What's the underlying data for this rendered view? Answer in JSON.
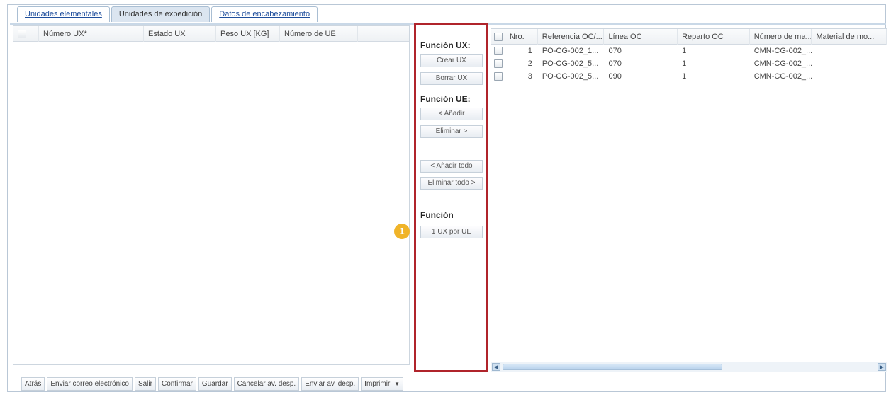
{
  "tabs": [
    {
      "label": "Unidades elementales",
      "active": false
    },
    {
      "label": "Unidades de expedición",
      "active": true
    },
    {
      "label": "Datos de encabezamiento",
      "active": false
    }
  ],
  "left_grid": {
    "columns": [
      "Número UX*",
      "Estado UX",
      "Peso UX [KG]",
      "Número de UE"
    ]
  },
  "functions": {
    "ux_label": "Función UX:",
    "create_ux": "Crear UX",
    "delete_ux": "Borrar UX",
    "ue_label": "Función UE:",
    "add": "< Añadir",
    "remove": "Eliminar >",
    "add_all": "< Añadir todo",
    "remove_all": "Eliminar todo >",
    "func_label": "Función",
    "one_ux_per_ue": "1 UX por UE",
    "badge": "1"
  },
  "right_grid": {
    "columns": [
      "Nro.",
      "Referencia OC/...",
      "Línea OC",
      "Reparto OC",
      "Número de ma...",
      "Material de mo..."
    ],
    "rows": [
      [
        "1",
        "PO-CG-002_1...",
        "070",
        "1",
        "CMN-CG-002_...",
        ""
      ],
      [
        "2",
        "PO-CG-002_5...",
        "070",
        "1",
        "CMN-CG-002_...",
        ""
      ],
      [
        "3",
        "PO-CG-002_5...",
        "090",
        "1",
        "CMN-CG-002_...",
        ""
      ]
    ]
  },
  "toolbar": {
    "buttons": [
      "Atrás",
      "Enviar correo electrónico",
      "Salir",
      "Confirmar",
      "Guardar",
      "Cancelar av. desp.",
      "Enviar av. desp."
    ],
    "print": "Imprimir"
  },
  "colors": {
    "highlight_border": "#b0242b",
    "badge": "#f0b429",
    "tab_active": "#dbe5f0"
  }
}
